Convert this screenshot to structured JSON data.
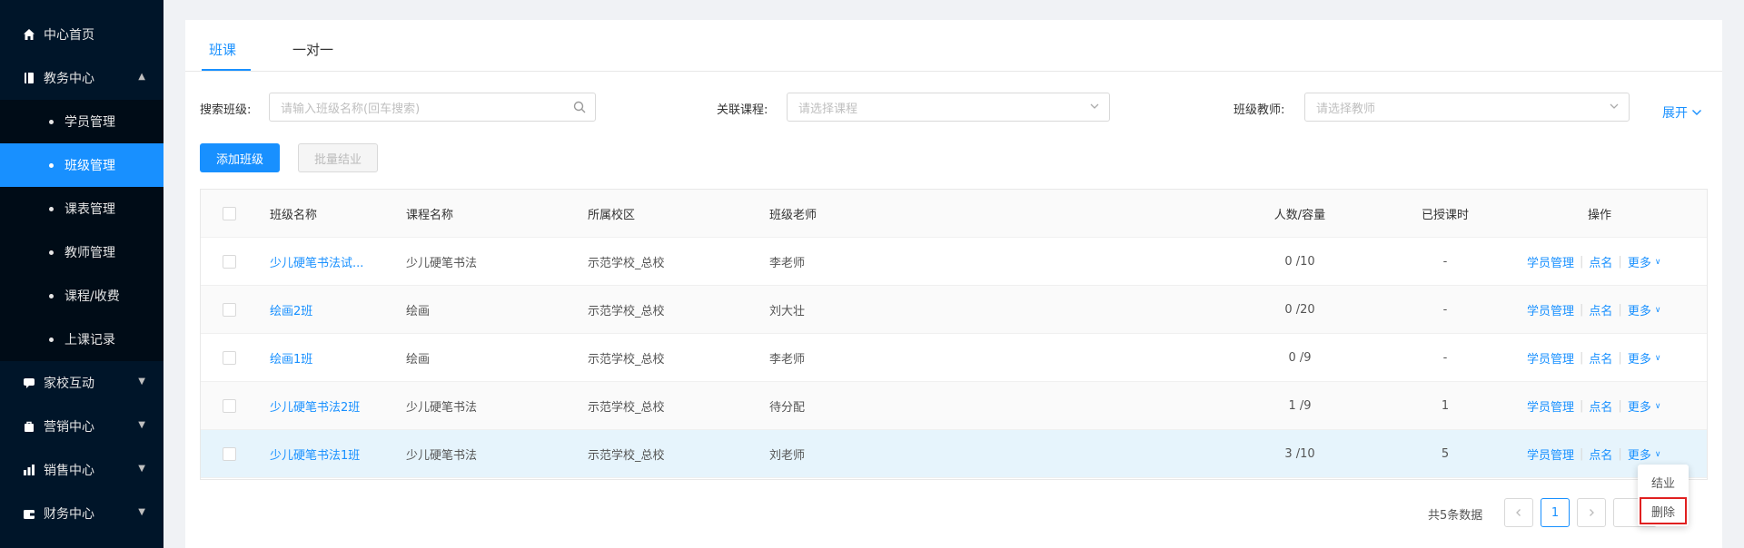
{
  "sidebar": {
    "items": [
      {
        "label": "中心首页",
        "icon": "home-icon"
      },
      {
        "label": "教务中心",
        "icon": "book-icon"
      },
      {
        "label": "家校互动",
        "icon": "chat-icon"
      },
      {
        "label": "营销中心",
        "icon": "bag-icon"
      },
      {
        "label": "销售中心",
        "icon": "chart-icon"
      },
      {
        "label": "财务中心",
        "icon": "wallet-icon"
      }
    ],
    "sub_items": [
      "学员管理",
      "班级管理",
      "课表管理",
      "教师管理",
      "课程/收费",
      "上课记录"
    ],
    "active_sub": "班级管理"
  },
  "tabs": [
    "班课",
    "一对一"
  ],
  "filters": {
    "class_label": "搜索班级:",
    "class_placeholder": "请输入班级名称(回车搜索)",
    "course_label": "关联课程:",
    "course_placeholder": "请选择课程",
    "teacher_label": "班级教师:",
    "teacher_placeholder": "请选择教师",
    "expand_label": "展开"
  },
  "actions": {
    "add_label": "添加班级",
    "batch_label": "批量结业"
  },
  "table": {
    "headers": [
      "班级名称",
      "课程名称",
      "所属校区",
      "班级老师",
      "人数/容量",
      "已授课时",
      "操作"
    ],
    "rows": [
      {
        "name": "少儿硬笔书法试...",
        "course": "少儿硬笔书法",
        "campus": "示范学校_总校",
        "teacher": "李老师",
        "capacity": "0 /10",
        "hours": "-"
      },
      {
        "name": "绘画2班",
        "course": "绘画",
        "campus": "示范学校_总校",
        "teacher": "刘大壮",
        "capacity": "0 /20",
        "hours": "-"
      },
      {
        "name": "绘画1班",
        "course": "绘画",
        "campus": "示范学校_总校",
        "teacher": "李老师",
        "capacity": "0 /9",
        "hours": "-"
      },
      {
        "name": "少儿硬笔书法2班",
        "course": "少儿硬笔书法",
        "campus": "示范学校_总校",
        "teacher": "待分配",
        "capacity": "1 /9",
        "hours": "1"
      },
      {
        "name": "少儿硬笔书法1班",
        "course": "少儿硬笔书法",
        "campus": "示范学校_总校",
        "teacher": "刘老师",
        "capacity": "3 /10",
        "hours": "5"
      }
    ],
    "op_students": "学员管理",
    "op_rollcall": "点名",
    "op_more": "更多"
  },
  "pagination": {
    "total_text": "共5条数据",
    "current_page": "1"
  },
  "dropdown": {
    "items": [
      "结业",
      "删除"
    ]
  },
  "colors": {
    "sidebar_bg": "#001529",
    "primary": "#1890ff",
    "highlight": "#e02020"
  }
}
